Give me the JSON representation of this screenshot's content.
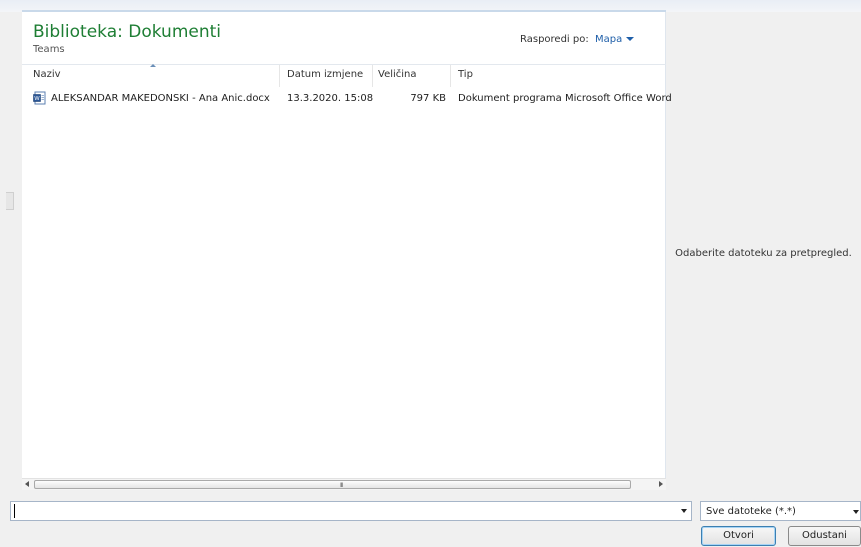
{
  "library": {
    "title": "Biblioteka: Dokumenti",
    "subtitle": "Teams",
    "arrange_label": "Rasporedi po:",
    "arrange_value": "Mapa"
  },
  "columns": {
    "name": "Naziv",
    "modified": "Datum izmjene",
    "size": "Veličina",
    "type": "Tip"
  },
  "files": [
    {
      "icon": "word-document-icon",
      "name": "ALEKSANDAR MAKEDONSKI - Ana Anic.docx",
      "modified": "13.3.2020. 15:08",
      "size": "797 KB",
      "type": "Dokument programa Microsoft Office Word"
    }
  ],
  "scrollbar": {
    "grip": "III"
  },
  "preview": {
    "message": "Odaberite datoteku za pretpregled."
  },
  "footer": {
    "filename_value": "",
    "filter_value": "Sve datoteke (*.*)",
    "open_label": "Otvori",
    "cancel_label": "Odustani"
  },
  "colors": {
    "title_green": "#1e7e34",
    "link_blue": "#1f5fa9"
  }
}
